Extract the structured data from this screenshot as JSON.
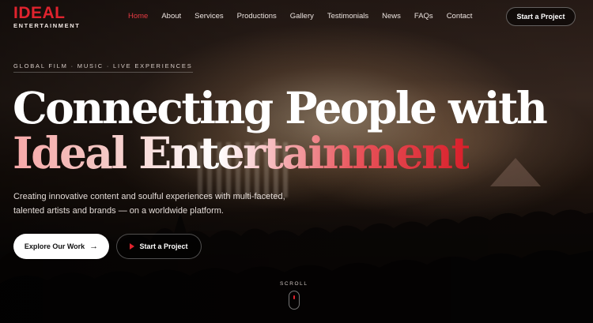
{
  "brand": {
    "name": "IDEAL",
    "sub": "ENTERTAINMENT",
    "accent": "#e0232e"
  },
  "nav": {
    "items": [
      {
        "label": "Home",
        "active": true
      },
      {
        "label": "About"
      },
      {
        "label": "Services"
      },
      {
        "label": "Productions"
      },
      {
        "label": "Gallery"
      },
      {
        "label": "Testimonials"
      },
      {
        "label": "News"
      },
      {
        "label": "FAQs"
      },
      {
        "label": "Contact"
      }
    ],
    "cta_label": "Start a Project"
  },
  "hero": {
    "tagline": "GLOBAL FILM · MUSIC · LIVE EXPERIENCES",
    "title_line1": "Connecting People with",
    "title_line2": "Ideal Entertainment",
    "description": "Creating innovative content and soulful experiences with multi-faceted, talented artists and brands — on a worldwide platform.",
    "primary_button": {
      "label": "Explore Our Work",
      "icon": "arrow-right-icon"
    },
    "secondary_button": {
      "label": "Start a Project",
      "icon": "play-icon"
    },
    "scroll_label": "SCROLL"
  }
}
